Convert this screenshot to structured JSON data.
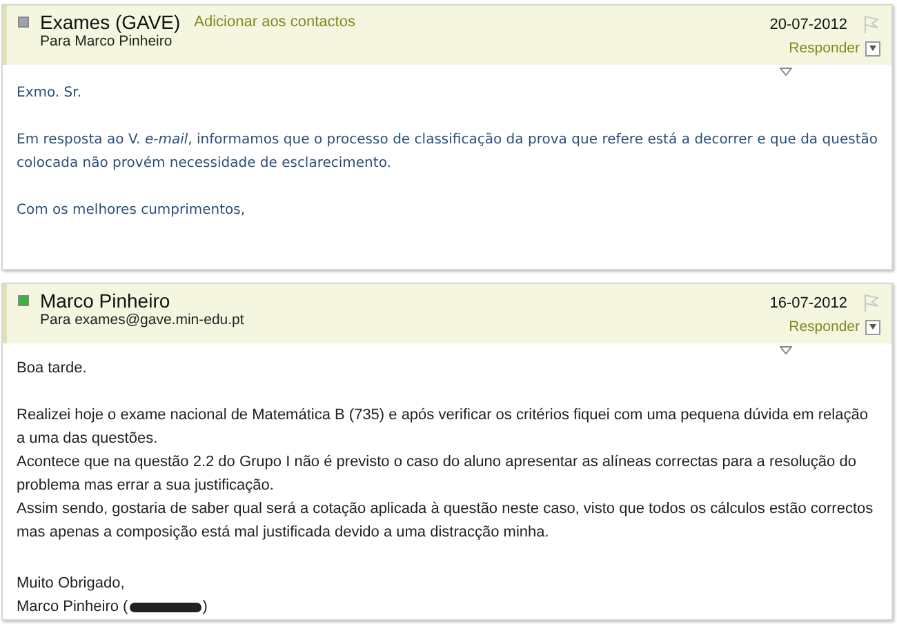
{
  "messages": [
    {
      "sender": "Exames (GAVE)",
      "color": "#9aa3b0",
      "add_contact": "Adicionar aos contactos",
      "recipient": "Para Marco Pinheiro",
      "date": "20-07-2012",
      "reply": "Responder",
      "paragraphs": [
        [
          "Exmo. Sr."
        ],
        [
          "Em resposta ao V. *e-mail*, informamos que o processo de classificação da prova que refere está a decorrer e que da questão colocada não provém necessidade de esclarecimento."
        ],
        [
          "Com os melhores cumprimentos,"
        ]
      ]
    },
    {
      "sender": "Marco Pinheiro",
      "color": "#3cb43c",
      "recipient": "Para exames@gave.min-edu.pt",
      "date": "16-07-2012",
      "reply": "Responder",
      "paragraphs": [
        [
          "Boa tarde."
        ],
        [
          "Realizei hoje o exame nacional de Matemática B (735) e após verificar os critérios fiquei com uma pequena dúvida em relação a uma das questões.",
          "Acontece que na questão 2.2 do Grupo I não é previsto o caso do aluno apresentar as alíneas correctas para a resolução do problema mas errar a sua justificação.",
          "Assim sendo, gostaria de saber qual será a cotação aplicada à questão neste caso, visto que todos os cálculos estão correctos mas apenas a composição está mal justificada devido a uma distracção minha."
        ]
      ],
      "closing": "Muito Obrigado,",
      "signature": {
        "before": "Marco Pinheiro (",
        "redacted": true,
        "after": ")"
      }
    }
  ]
}
